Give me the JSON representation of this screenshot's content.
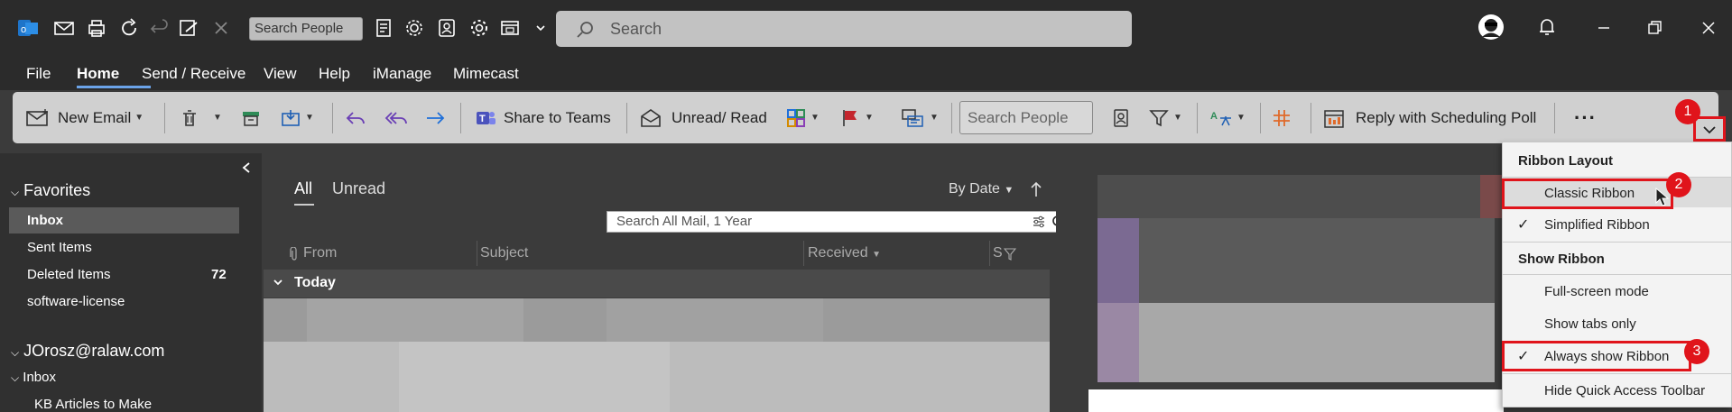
{
  "titlebar": {
    "search_people_placeholder": "Search People",
    "search_placeholder": "Search"
  },
  "menu_tabs": [
    "File",
    "Home",
    "Send / Receive",
    "View",
    "Help",
    "iManage",
    "Mimecast"
  ],
  "ribbon": {
    "new_email": "New Email",
    "share_to_teams": "Share to Teams",
    "unread_read": "Unread/ Read",
    "search_people": "Search People",
    "reply_scheduling_poll": "Reply with Scheduling Poll",
    "more": "···"
  },
  "nav": {
    "favorites": "Favorites",
    "inbox": "Inbox",
    "sent_items": "Sent Items",
    "deleted_items": "Deleted Items",
    "deleted_count": "72",
    "software_license": "software-license",
    "account": "JOrosz@ralaw.com",
    "inbox2": "Inbox",
    "kb_articles": "KB Articles to Make"
  },
  "message_list": {
    "tab_all": "All",
    "tab_unread": "Unread",
    "sort": "By Date",
    "search_all": "Search All Mail, 1 Year",
    "col_from": "From",
    "col_subject": "Subject",
    "col_received": "Received",
    "col_s": "S",
    "group_today": "Today"
  },
  "dropdown": {
    "ribbon_layout": "Ribbon Layout",
    "classic_ribbon": "Classic Ribbon",
    "simplified_ribbon": "Simplified Ribbon",
    "show_ribbon": "Show Ribbon",
    "full_screen": "Full-screen mode",
    "show_tabs_only": "Show tabs only",
    "always_show": "Always show Ribbon",
    "hide_qat": "Hide Quick Access Toolbar",
    "check_simplified": "✓",
    "check_always": "✓"
  },
  "badges": [
    "1",
    "2",
    "3"
  ],
  "colors": {
    "accent_blue": "#6ba3e8",
    "highlight_red": "#e0141b",
    "flag_red": "#c4262e"
  }
}
